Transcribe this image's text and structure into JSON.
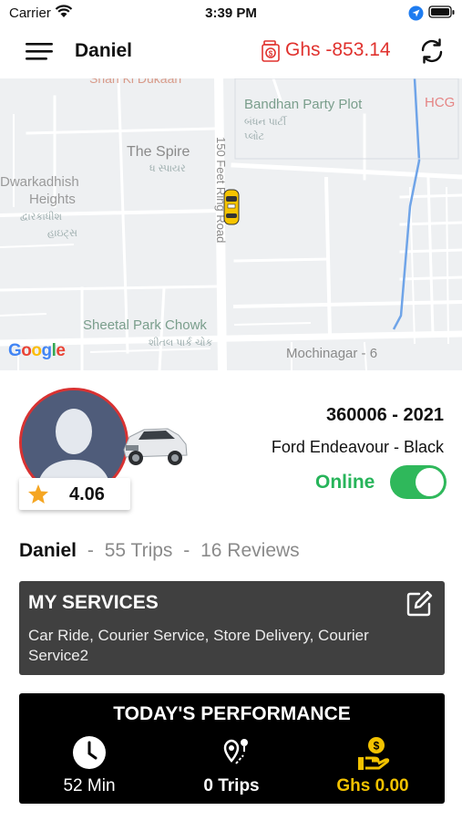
{
  "status_bar": {
    "carrier": "Carrier",
    "time": "3:39 PM"
  },
  "header": {
    "driver_name": "Daniel",
    "balance": "Ghs -853.14"
  },
  "map": {
    "labels": {
      "dukaan": "Shari Ki Dukaan",
      "bandhan": "Bandhan Party Plot",
      "bandhan_local_1": "બંધન પાર્ટી",
      "bandhan_local_2": "પ્લોટ",
      "hcg": "HCG",
      "spire": "The Spire",
      "spire_local": "ધ સ્પાયર",
      "road": "150 Feet Ring Road",
      "dwarkadhish_1": "Dwarkadhish",
      "dwarkadhish_2": "Heights",
      "dwarkadhish_local_1": "દ્વારકાધીશ",
      "dwarkadhish_local_2": "હાઇટ્સ",
      "sheetal": "Sheetal Park Chowk",
      "sheetal_local": "શીતલ પાર્ક ચોક",
      "mochinagar": "Mochinagar - 6"
    },
    "google_logo": "Google"
  },
  "profile": {
    "rating": "4.06",
    "vehicle_number": "360006 - 2021",
    "vehicle_model": "Ford Endeavour - Black",
    "status": "Online",
    "online": true
  },
  "stats": {
    "name": "Daniel",
    "sep1": "-",
    "trips": "55 Trips",
    "sep2": "-",
    "reviews": "16 Reviews"
  },
  "services": {
    "title": "MY SERVICES",
    "list": "Car Ride, Courier Service, Store Delivery, Courier Service2"
  },
  "performance": {
    "title": "TODAY'S PERFORMANCE",
    "time": "52 Min",
    "trips": "0 Trips",
    "earnings": "Ghs 0.00"
  },
  "colors": {
    "accent_red": "#e0322e",
    "online_green": "#27b45a",
    "earnings_gold": "#f2c200",
    "card_dark": "#404040"
  },
  "icons": [
    "wifi-icon",
    "location-arrow-icon",
    "battery-icon",
    "menu-icon",
    "wallet-icon",
    "refresh-icon",
    "taxi-icon",
    "star-icon",
    "edit-icon",
    "clock-icon",
    "route-icon",
    "money-hand-icon"
  ]
}
